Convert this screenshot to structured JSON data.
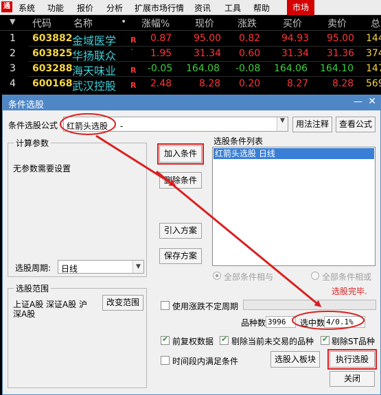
{
  "menu": {
    "items": [
      "系统",
      "功能",
      "报价",
      "分析",
      "扩展市场行情",
      "资讯",
      "工具",
      "帮助"
    ],
    "market": "市场"
  },
  "table": {
    "headers": [
      "代码",
      "名称",
      "•",
      "涨幅%",
      "现价",
      "涨跌",
      "买价",
      "卖价",
      "总"
    ],
    "rows": [
      {
        "idx": "1",
        "code": "603882",
        "name": "金域医学",
        "flag": "R",
        "chg_pct": "0.87",
        "price": "95.00",
        "chg": "0.82",
        "bid": "94.93",
        "ask": "95.00",
        "vol": "144"
      },
      {
        "idx": "2",
        "code": "603825",
        "name": "华扬联众",
        "flag": "·",
        "chg_pct": "1.95",
        "price": "31.34",
        "chg": "0.60",
        "bid": "31.34",
        "ask": "31.36",
        "vol": "374"
      },
      {
        "idx": "3",
        "code": "603288",
        "name": "海天味业",
        "flag": "R",
        "chg_pct": "-0.05",
        "price": "164.08",
        "chg": "-0.08",
        "bid": "164.06",
        "ask": "164.10",
        "vol": "147"
      },
      {
        "idx": "4",
        "code": "600168",
        "name": "武汉控股",
        "flag": "R",
        "chg_pct": "2.48",
        "price": "8.28",
        "chg": "0.20",
        "bid": "8.27",
        "ask": "8.28",
        "vol": "569"
      }
    ]
  },
  "dialog": {
    "title": "条件选股",
    "formula_label": "条件选股公式",
    "formula_value": "红箭头选股",
    "formula_suffix": " -",
    "btn_usage": "用法注释",
    "btn_view": "查看公式",
    "calc_group": "计算参数",
    "no_params": "无参数需要设置",
    "period_label": "选股周期:",
    "period_value": "日线",
    "range_group": "选股范围",
    "range_text_1": "上证A股 深证A股 沪",
    "range_text_2": "深A股",
    "btn_change_range": "改变范围",
    "btn_add": "加入条件",
    "btn_delete": "删除条件",
    "btn_import": "引入方案",
    "btn_save": "保存方案",
    "list_label": "选股条件列表",
    "list_items": [
      "红箭头选股  日线"
    ],
    "radio_and": "全部条件相与",
    "radio_or": "全部条件相或",
    "status": "选股完毕.",
    "chk_uncertain": "使用涨跌不定周期",
    "count_label": "品种数",
    "count_value": "3996",
    "selected_label": "选中数",
    "selected_value": "4/0.1%",
    "chk_restore": "前复权数据",
    "chk_exclude_inactive": "剔除当前未交易的品种",
    "chk_exclude_st": "剔除ST品种",
    "chk_period_satisfy": "时间段内满足条件",
    "btn_to_block": "选股入板块",
    "btn_execute": "执行选股",
    "btn_close": "关闭"
  },
  "colors": {
    "accent_red": "#d92020",
    "title_blue": "#4f87c6",
    "code_yellow": "#f5d548",
    "name_cyan": "#3fd0d9",
    "up_red": "#ff3535",
    "down_green": "#3dd13d"
  }
}
